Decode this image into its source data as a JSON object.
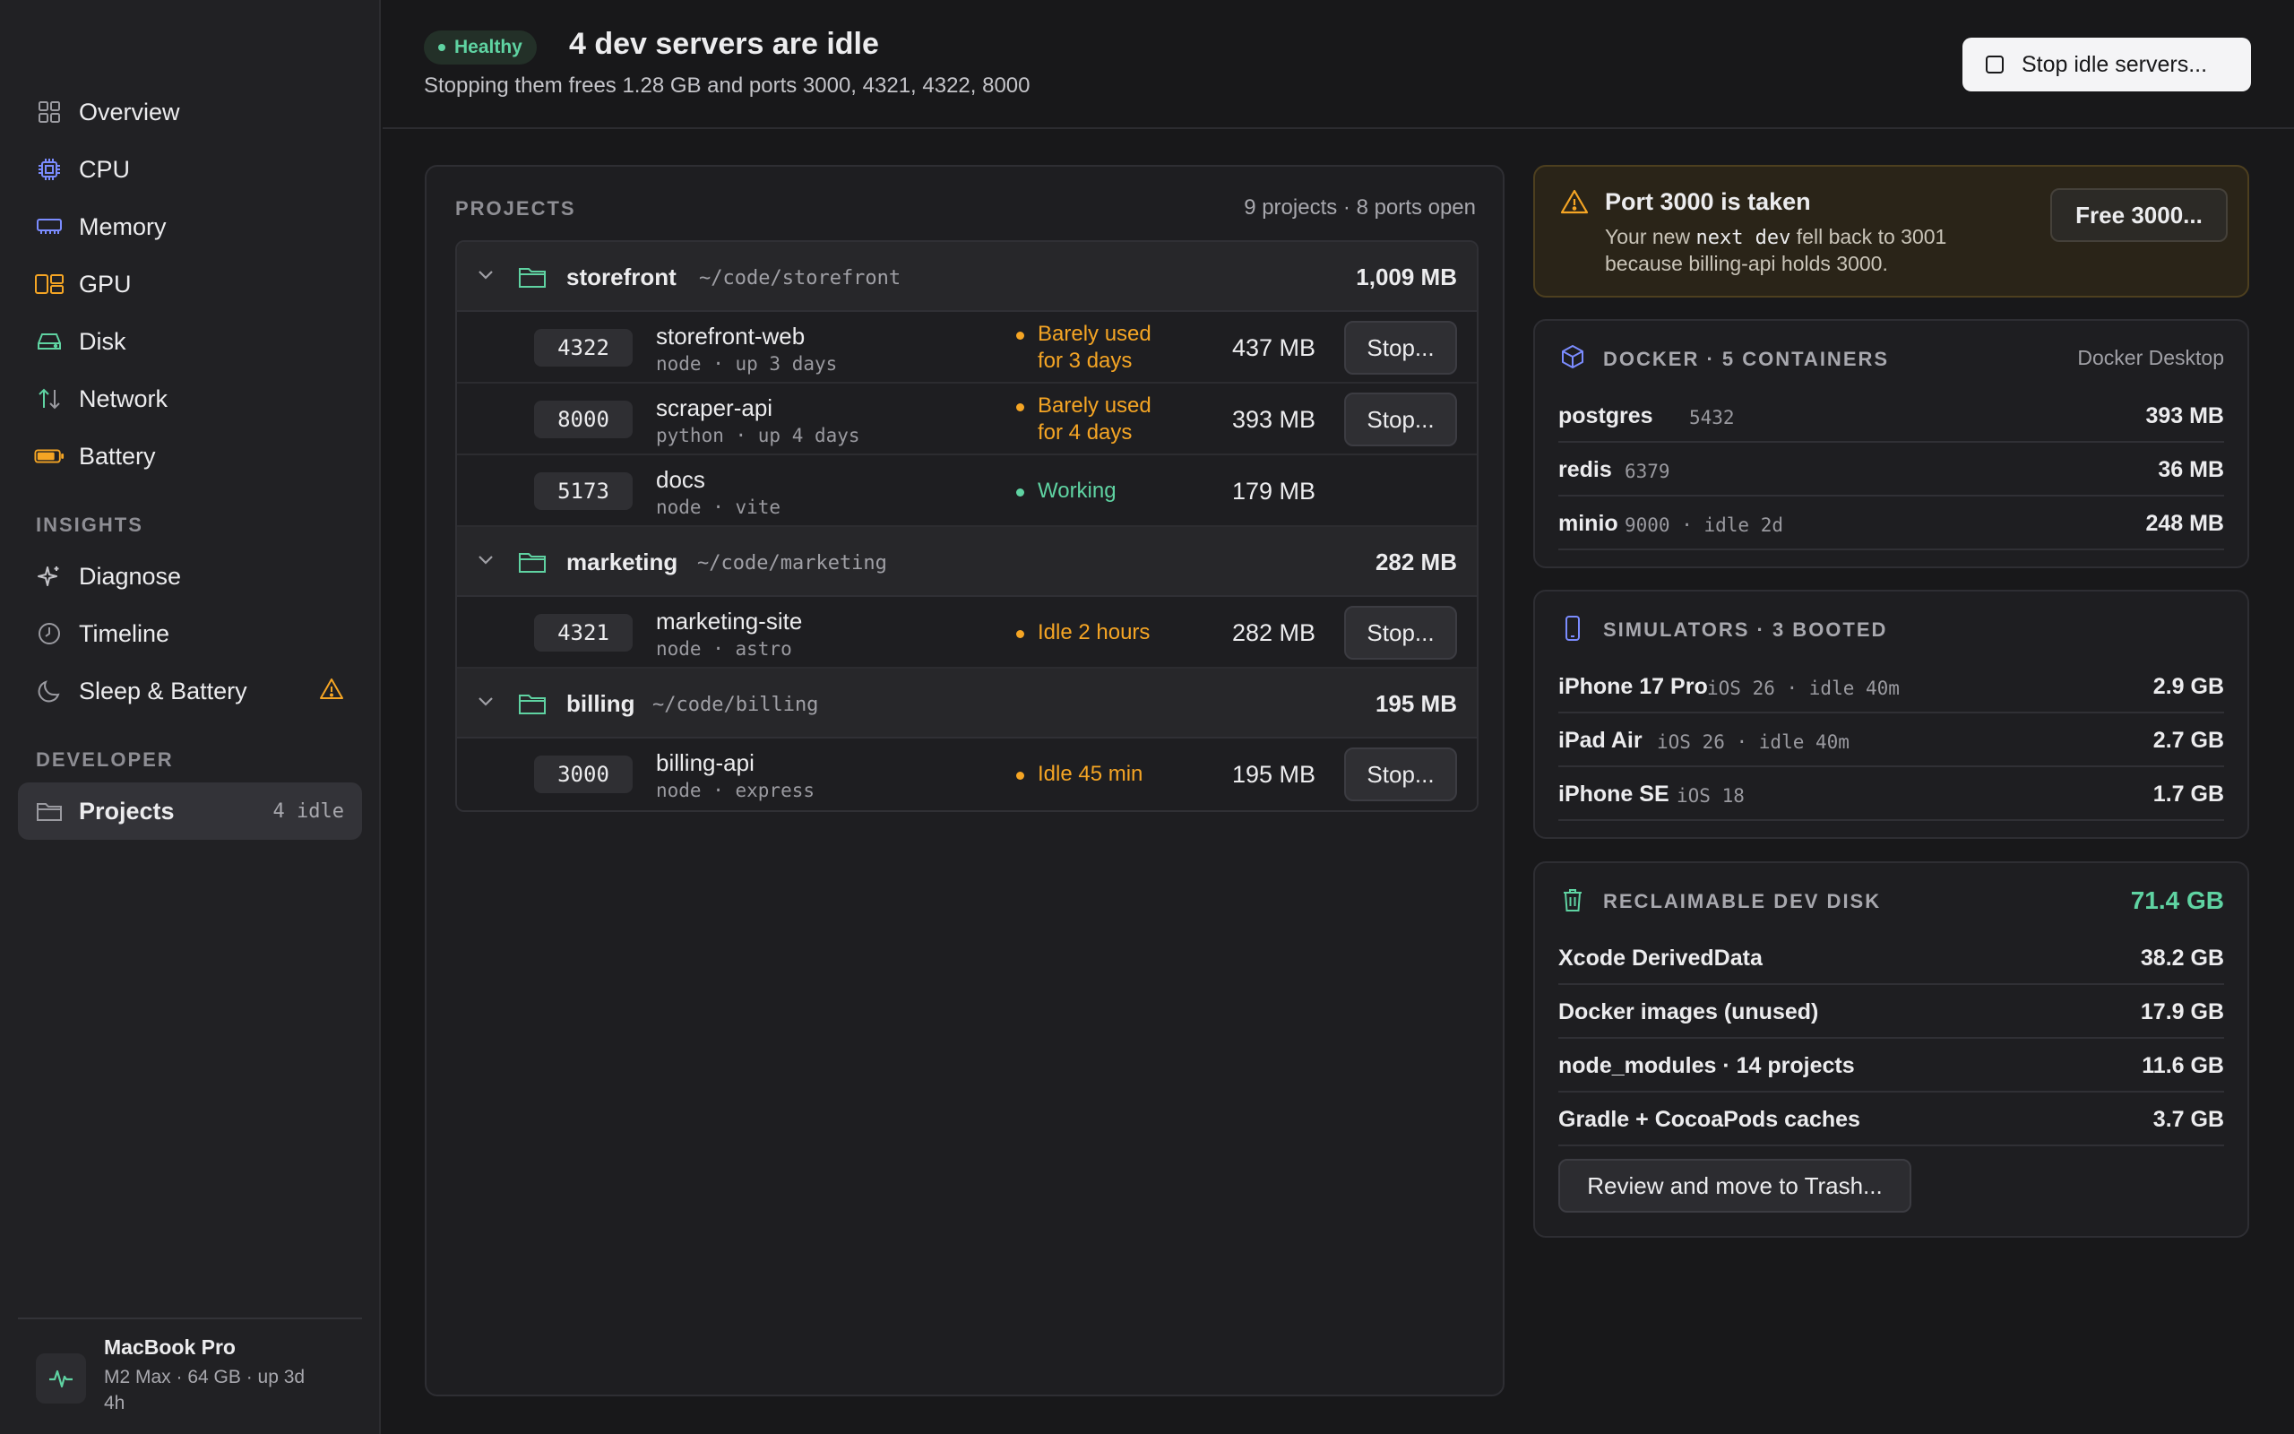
{
  "sidebar": {
    "items": [
      {
        "label": "Overview",
        "icon": "grid-icon"
      },
      {
        "label": "CPU",
        "icon": "cpu-icon"
      },
      {
        "label": "Memory",
        "icon": "memory-icon"
      },
      {
        "label": "GPU",
        "icon": "gpu-icon"
      },
      {
        "label": "Disk",
        "icon": "disk-icon"
      },
      {
        "label": "Network",
        "icon": "network-icon"
      },
      {
        "label": "Battery",
        "icon": "battery-icon"
      }
    ],
    "insights_heading": "INSIGHTS",
    "insights": [
      {
        "label": "Diagnose",
        "icon": "sparkle-icon"
      },
      {
        "label": "Timeline",
        "icon": "clock-icon"
      },
      {
        "label": "Sleep & Battery",
        "icon": "moon-icon",
        "warning": true
      }
    ],
    "developer_heading": "DEVELOPER",
    "developer": [
      {
        "label": "Projects",
        "icon": "folder-icon",
        "count": "4 idle",
        "active": true
      }
    ],
    "machine": {
      "name": "MacBook Pro",
      "details": "M2 Max · 64 GB · up 3d 4h"
    }
  },
  "header": {
    "badge": "Healthy",
    "title": "4 dev servers are idle",
    "subtitle": "Stopping them frees 1.28 GB and ports 3000, 4321, 4322, 8000",
    "stop_idle_label": "Stop idle servers..."
  },
  "projects": {
    "heading": "PROJECTS",
    "summary": "9 projects · 8 ports open",
    "groups": [
      {
        "name": "storefront",
        "path": "~/code/storefront",
        "memory": "1,009 MB",
        "servers": [
          {
            "port": "4322",
            "name": "storefront-web",
            "meta": "node · up 3 days",
            "status_line1": "Barely used",
            "status_line2": "for 3 days",
            "status_kind": "warn",
            "memory": "437 MB",
            "action": "Stop..."
          },
          {
            "port": "8000",
            "name": "scraper-api",
            "meta": "python · up 4 days",
            "status_line1": "Barely used",
            "status_line2": "for 4 days",
            "status_kind": "warn",
            "memory": "393 MB",
            "action": "Stop..."
          },
          {
            "port": "5173",
            "name": "docs",
            "meta": "node · vite",
            "status_line1": "Working",
            "status_line2": "",
            "status_kind": "ok",
            "memory": "179 MB",
            "action": ""
          }
        ]
      },
      {
        "name": "marketing",
        "path": "~/code/marketing",
        "memory": "282 MB",
        "servers": [
          {
            "port": "4321",
            "name": "marketing-site",
            "meta": "node · astro",
            "status_line1": "Idle 2 hours",
            "status_line2": "",
            "status_kind": "warn",
            "memory": "282 MB",
            "action": "Stop..."
          }
        ]
      },
      {
        "name": "billing",
        "path": "~/code/billing",
        "memory": "195 MB",
        "servers": [
          {
            "port": "3000",
            "name": "billing-api",
            "meta": "node · express",
            "status_line1": "Idle 45 min",
            "status_line2": "",
            "status_kind": "warn",
            "memory": "195 MB",
            "action": "Stop..."
          }
        ]
      }
    ]
  },
  "alert": {
    "title": "Port 3000 is taken",
    "body_pre": "Your new ",
    "body_code": "next dev",
    "body_post": " fell back to 3001 because billing-api holds 3000.",
    "action": "Free 3000..."
  },
  "docker": {
    "title": "DOCKER · 5 CONTAINERS",
    "source": "Docker Desktop",
    "rows": [
      {
        "name": "postgres",
        "meta": "5432",
        "value": "393 MB"
      },
      {
        "name": "redis",
        "meta": "6379",
        "value": "36 MB"
      },
      {
        "name": "minio",
        "meta": "9000 · idle 2d",
        "value": "248 MB"
      }
    ]
  },
  "simulators": {
    "title": "SIMULATORS · 3 BOOTED",
    "rows": [
      {
        "name": "iPhone 17 Pro",
        "meta": "iOS 26 · idle 40m",
        "value": "2.9 GB"
      },
      {
        "name": "iPad Air",
        "meta": "iOS 26 · idle 40m",
        "value": "2.7 GB"
      },
      {
        "name": "iPhone SE",
        "meta": "iOS 18",
        "value": "1.7 GB"
      }
    ]
  },
  "disk": {
    "title": "RECLAIMABLE DEV DISK",
    "total": "71.4 GB",
    "rows": [
      {
        "name": "Xcode DerivedData",
        "value": "38.2 GB"
      },
      {
        "name": "Docker images (unused)",
        "value": "17.9 GB"
      },
      {
        "name": "node_modules · 14 projects",
        "value": "11.6 GB"
      },
      {
        "name": "Gradle + CocoaPods caches",
        "value": "3.7 GB"
      }
    ],
    "action": "Review and move to Trash..."
  },
  "colors": {
    "accent_green": "#5fd3a2",
    "warning_orange": "#f5a524",
    "icon_blue": "#7b8cff"
  }
}
